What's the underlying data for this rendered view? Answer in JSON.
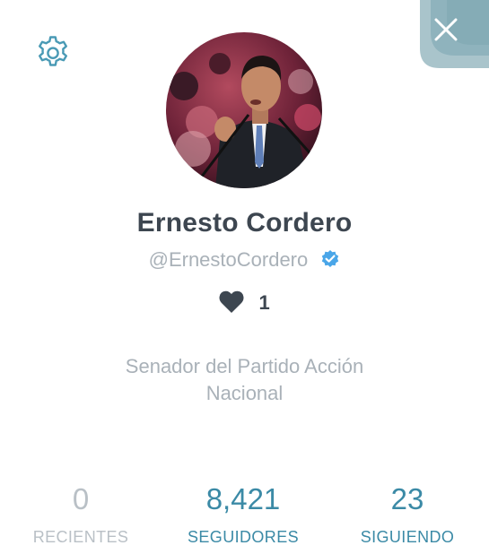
{
  "profile": {
    "name": "Ernesto Cordero",
    "handle": "@ErnestoCordero",
    "likes": "1",
    "bio_line1": "Senador del Partido Acción",
    "bio_line2": "Nacional"
  },
  "stats": {
    "recientes": {
      "value": "0",
      "label": "RECIENTES"
    },
    "seguidores": {
      "value": "8,421",
      "label": "SEGUIDORES"
    },
    "siguiendo": {
      "value": "23",
      "label": "SIGUIENDO"
    }
  },
  "icons": {
    "settings": "gear-icon",
    "close": "close-icon",
    "verified": "verified-badge-icon",
    "likes": "heart-icon"
  },
  "colors": {
    "accent": "#3b8aa6",
    "name": "#3d4650",
    "muted": "#a9b1b8",
    "verified": "#4aa6e8",
    "close_tab": "#9fbfc7"
  }
}
